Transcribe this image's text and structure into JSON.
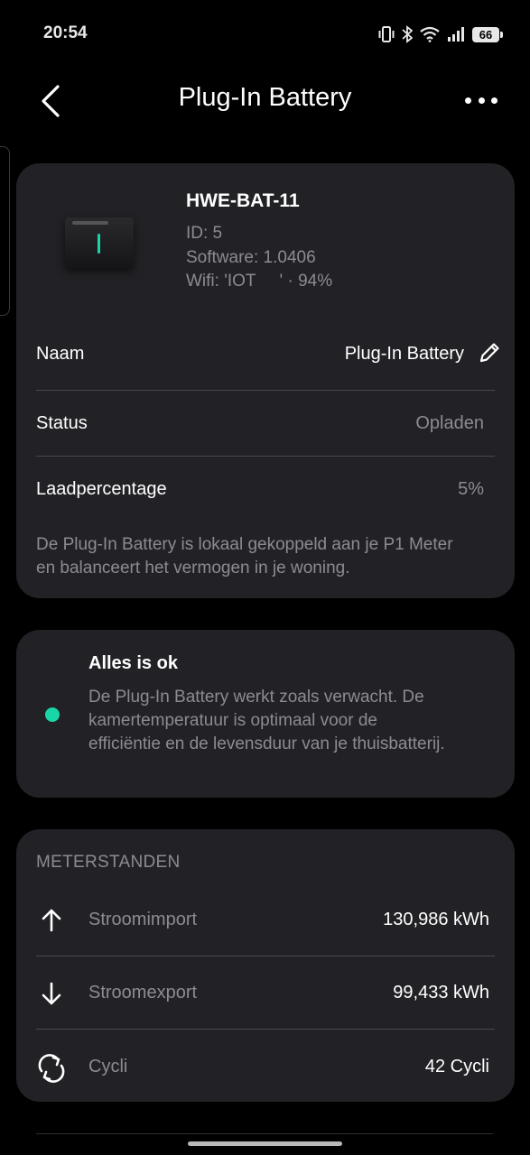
{
  "status_bar": {
    "time": "20:54",
    "battery": "66"
  },
  "header": {
    "title": "Plug-In Battery"
  },
  "device": {
    "name": "HWE-BAT-11",
    "id": "ID: 5",
    "software": "Software: 1.0406",
    "wifi": "Wifi: 'IOT     ' · 94%"
  },
  "details": [
    {
      "label": "Naam",
      "value": "Plug-In Battery"
    },
    {
      "label": "Status",
      "value": "Opladen"
    },
    {
      "label": "Laadpercentage",
      "value": "5%"
    }
  ],
  "description": "De Plug-In Battery is lokaal gekoppeld aan je P1 Meter en balanceert het vermogen in je woning.",
  "status_card": {
    "title": "Alles is ok",
    "text": "De Plug-In Battery werkt zoals verwacht. De kamertemperatuur is optimaal voor de efficiëntie en de levensduur van je thuisbatterij.",
    "indicator_color": "#19d6a6"
  },
  "meters": {
    "title": "METERSTANDEN",
    "items": [
      {
        "icon": "arrow-up-icon",
        "label": "Stroomimport",
        "value": "130,986 kWh"
      },
      {
        "icon": "arrow-down-icon",
        "label": "Stroomexport",
        "value": "99,433 kWh"
      },
      {
        "icon": "cycle-icon",
        "label": "Cycli",
        "value": "42 Cycli"
      }
    ]
  },
  "colors": {
    "background": "#000000",
    "card": "#222226",
    "accent": "#19d6a6",
    "muted": "#8b8b92"
  }
}
